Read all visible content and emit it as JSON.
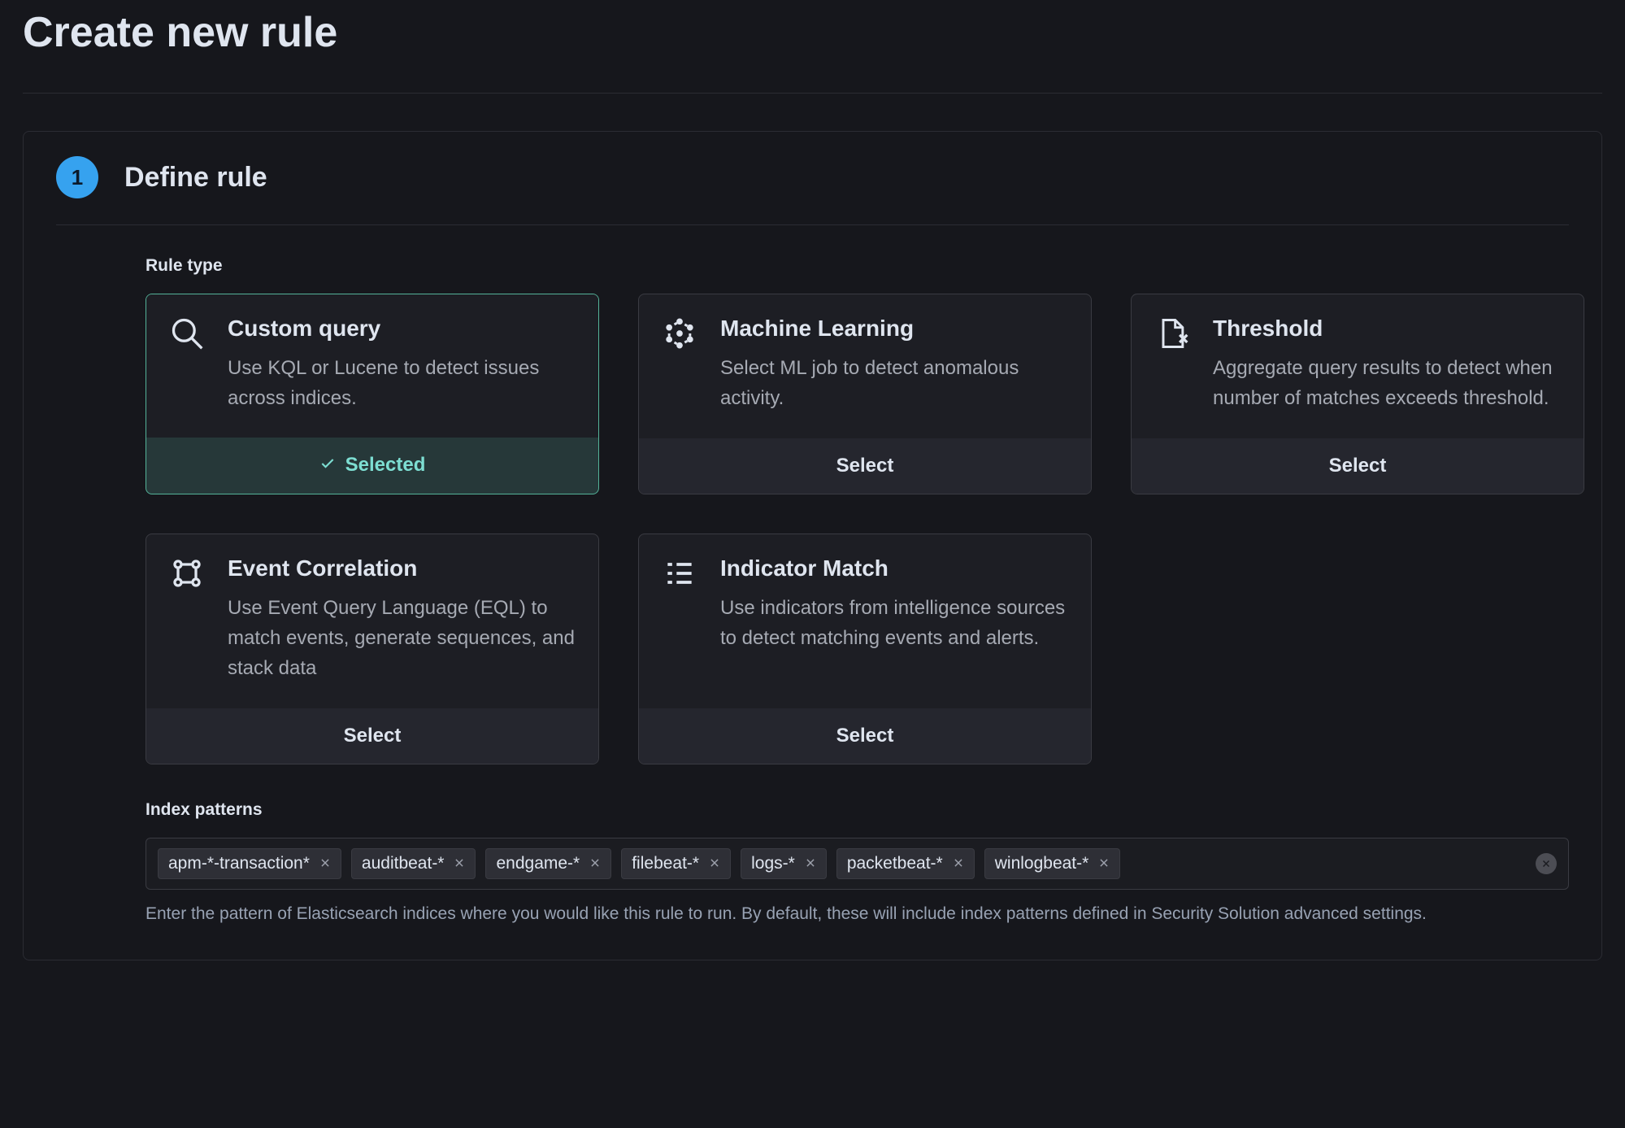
{
  "page": {
    "title": "Create new rule"
  },
  "step": {
    "number": "1",
    "title": "Define rule"
  },
  "rule_type": {
    "label": "Rule type",
    "selected_label": "Selected",
    "select_label": "Select",
    "cards": [
      {
        "title": "Custom query",
        "desc": "Use KQL or Lucene to detect issues across indices.",
        "selected": true
      },
      {
        "title": "Machine Learning",
        "desc": "Select ML job to detect anomalous activity.",
        "selected": false
      },
      {
        "title": "Threshold",
        "desc": "Aggregate query results to detect when number of matches exceeds threshold.",
        "selected": false
      },
      {
        "title": "Event Correlation",
        "desc": "Use Event Query Language (EQL) to match events, generate sequences, and stack data",
        "selected": false
      },
      {
        "title": "Indicator Match",
        "desc": "Use indicators from intelligence sources to detect matching events and alerts.",
        "selected": false
      }
    ]
  },
  "index_patterns": {
    "label": "Index patterns",
    "items": [
      "apm-*-transaction*",
      "auditbeat-*",
      "endgame-*",
      "filebeat-*",
      "logs-*",
      "packetbeat-*",
      "winlogbeat-*"
    ],
    "help": "Enter the pattern of Elasticsearch indices where you would like this rule to run. By default, these will include index patterns defined in Security Solution advanced settings."
  }
}
